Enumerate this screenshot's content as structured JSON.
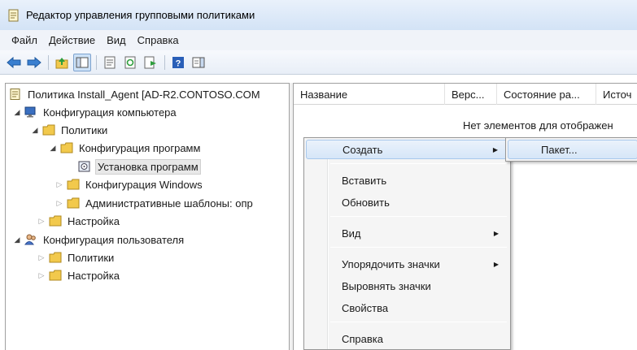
{
  "window": {
    "title": "Редактор управления групповыми политиками",
    "icon": "gpo-editor-icon"
  },
  "menubar": {
    "items": [
      {
        "label": "Файл"
      },
      {
        "label": "Действие"
      },
      {
        "label": "Вид"
      },
      {
        "label": "Справка"
      }
    ]
  },
  "toolbar": {
    "buttons": [
      "back-icon",
      "forward-icon",
      "up-folder-icon",
      "show-hide-tree-icon",
      "properties-icon",
      "refresh-icon",
      "export-list-icon",
      "help-icon",
      "show-action-pane-icon"
    ]
  },
  "tree": {
    "items": [
      {
        "label": "Политика Install_Agent [AD-R2.CONTOSO.COM",
        "icon": "policy-icon",
        "expander": ""
      },
      {
        "label": "Конфигурация компьютера",
        "icon": "computer-icon",
        "expander": "expanded"
      },
      {
        "label": "Политики",
        "icon": "folder-icon",
        "expander": "expanded"
      },
      {
        "label": "Конфигурация программ",
        "icon": "folder-icon",
        "expander": "expanded"
      },
      {
        "label": "Установка программ",
        "icon": "software-install-icon",
        "expander": "",
        "selected": true
      },
      {
        "label": "Конфигурация Windows",
        "icon": "folder-icon",
        "expander": "collapsed"
      },
      {
        "label": "Административные шаблоны: опр",
        "icon": "folder-icon",
        "expander": "collapsed"
      },
      {
        "label": "Настройка",
        "icon": "folder-icon",
        "expander": "collapsed"
      },
      {
        "label": "Конфигурация пользователя",
        "icon": "users-icon",
        "expander": "expanded"
      },
      {
        "label": "Политики",
        "icon": "folder-icon",
        "expander": "collapsed"
      },
      {
        "label": "Настройка",
        "icon": "folder-icon",
        "expander": "collapsed"
      }
    ]
  },
  "list": {
    "columns": [
      {
        "label": "Название"
      },
      {
        "label": "Верс..."
      },
      {
        "label": "Состояние ра..."
      },
      {
        "label": "Источ"
      }
    ],
    "empty_message": "Нет элементов для отображен"
  },
  "context_menu": {
    "items": [
      {
        "label": "Создать",
        "has_submenu": true,
        "highlighted": true
      },
      {
        "label": "Вставить"
      },
      {
        "label": "Обновить"
      },
      {
        "label": "Вид",
        "has_submenu": true
      },
      {
        "label": "Упорядочить значки",
        "has_submenu": true
      },
      {
        "label": "Выровнять значки"
      },
      {
        "label": "Свойства"
      },
      {
        "label": "Справка"
      }
    ],
    "submenu_arrow": "▶"
  },
  "submenu": {
    "items": [
      {
        "label": "Пакет..."
      }
    ]
  },
  "colors": {
    "titlebar": "#d3e3f6",
    "menu_highlight": "#d6e6f8",
    "folder": "#f2c94c"
  }
}
